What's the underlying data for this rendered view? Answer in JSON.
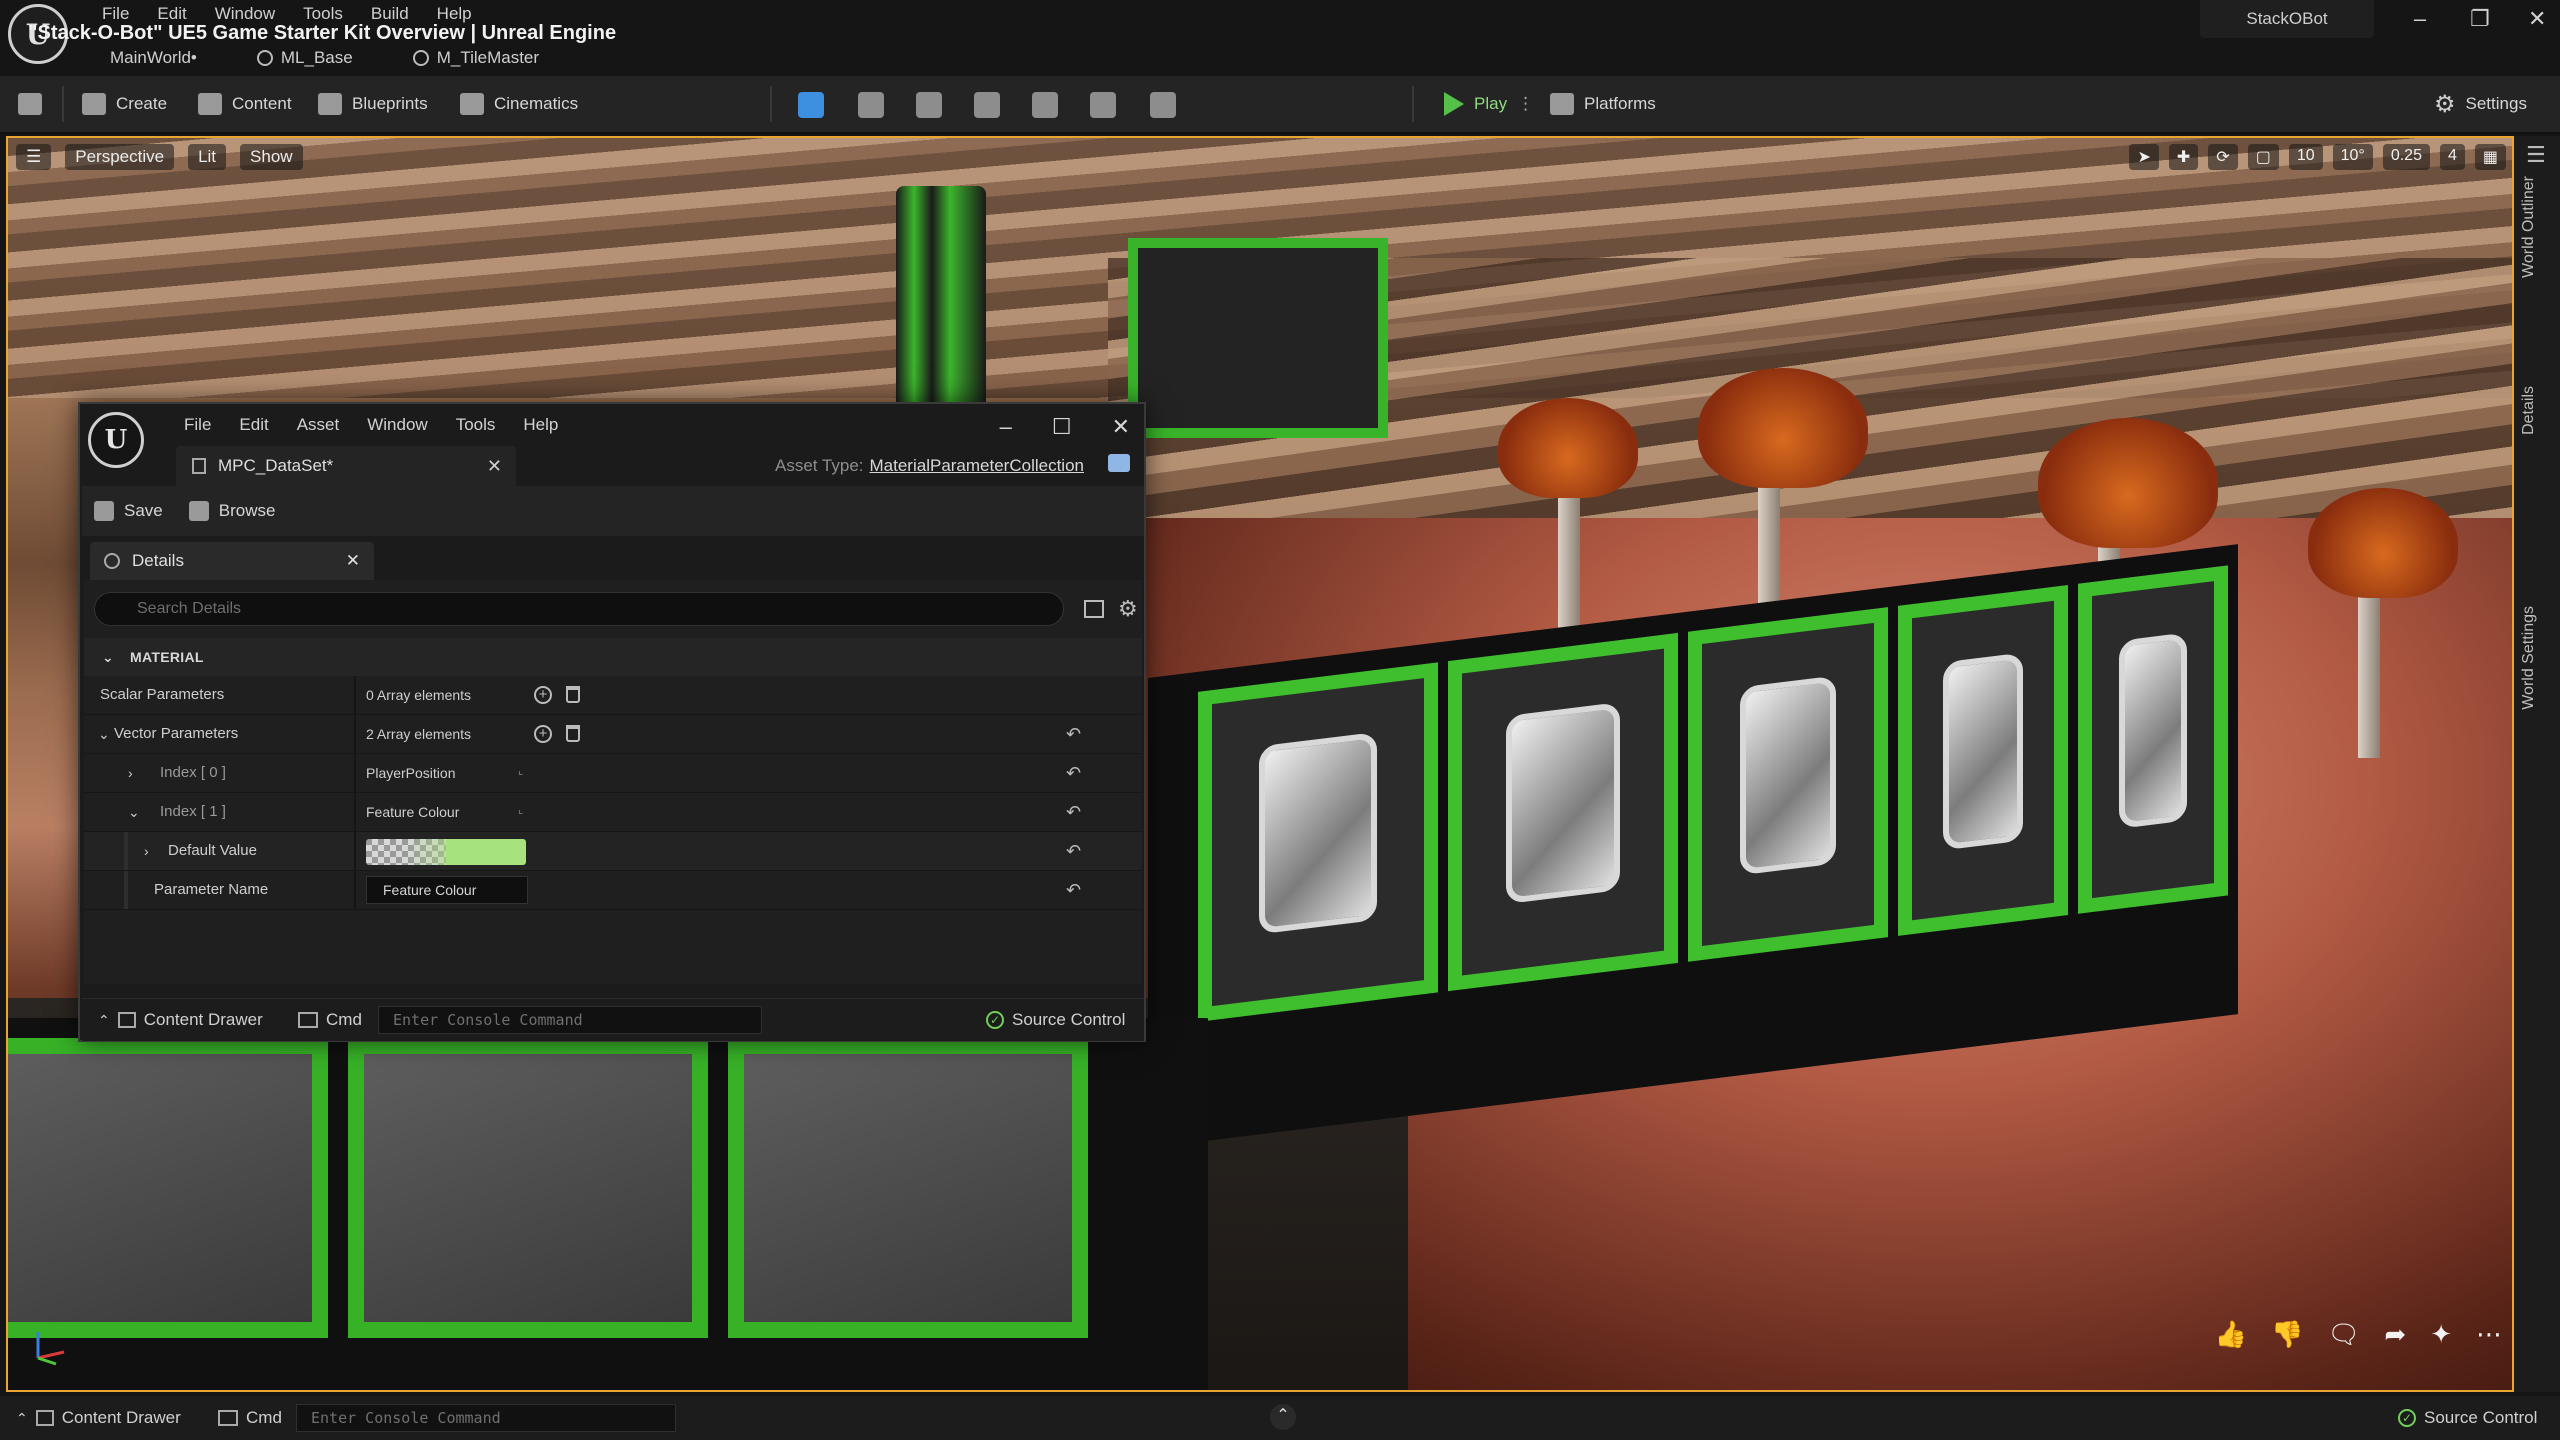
{
  "app": {
    "title": "\"Stack-O-Bot\" UE5 Game Starter Kit Overview | Unreal Engine",
    "logo_text": "U",
    "menu": [
      "File",
      "Edit",
      "Window",
      "Tools",
      "Build",
      "Help"
    ],
    "tabs": [
      {
        "label": "MainWorld•",
        "icon": "level-icon"
      },
      {
        "label": "ML_Base",
        "icon": "material-function-icon"
      },
      {
        "label": "M_TileMaster",
        "icon": "material-icon"
      }
    ],
    "project_name": "StackOBot",
    "window_controls": {
      "minimize": "–",
      "restore": "❐",
      "close": "✕"
    }
  },
  "toolbar": {
    "save_icon": "save-icon",
    "create": "Create",
    "content": "Content",
    "blueprints": "Blueprints",
    "cinematics": "Cinematics",
    "play": "Play",
    "platforms": "Platforms",
    "settings": "Settings",
    "modes": [
      "select-mode-icon",
      "landscape-mode-icon",
      "foliage-mode-icon",
      "mesh-paint-mode-icon",
      "fracture-mode-icon",
      "brush-edit-mode-icon",
      "animation-mode-icon"
    ]
  },
  "viewport": {
    "perspective": "Perspective",
    "lit": "Lit",
    "show": "Show",
    "grid_snap": "10",
    "rotation_snap": "10°",
    "scale_snap": "0.25",
    "camera_speed": "4",
    "side_labels": [
      "World Outliner",
      "Details",
      "World Settings"
    ],
    "overlay_icons": [
      "thumbs-up-icon",
      "thumbs-down-icon",
      "comment-icon",
      "share-icon",
      "sparkle-icon",
      "more-icon"
    ]
  },
  "asset_editor": {
    "menu": [
      "File",
      "Edit",
      "Asset",
      "Window",
      "Tools",
      "Help"
    ],
    "tab_label": "MPC_DataSet*",
    "asset_type_label": "Asset Type:",
    "asset_type_value": "MaterialParameterCollection",
    "save": "Save",
    "browse": "Browse",
    "details_tab": "Details",
    "search_placeholder": "Search Details",
    "category": "MATERIAL",
    "rows": {
      "scalar_name": "Scalar Parameters",
      "scalar_value": "0 Array elements",
      "vector_name": "Vector Parameters",
      "vector_value": "2 Array elements",
      "index0_name": "Index [ 0 ]",
      "index0_value": "PlayerPosition",
      "index1_name": "Index [ 1 ]",
      "index1_value": "Feature Colour",
      "default_value_name": "Default Value",
      "default_color": "#a6e37c",
      "param_name_label": "Parameter Name",
      "param_name_value": "Feature Colour"
    },
    "status": {
      "content_drawer": "Content Drawer",
      "cmd": "Cmd",
      "console_placeholder": "Enter Console Command",
      "source_control": "Source Control"
    }
  },
  "statusbar": {
    "content_drawer": "Content Drawer",
    "cmd": "Cmd",
    "console_placeholder": "Enter Console Command",
    "source_control": "Source Control"
  },
  "colors": {
    "accent_orange": "#e8a531",
    "play_green": "#57c049",
    "panel_green": "#3fbf2e"
  }
}
